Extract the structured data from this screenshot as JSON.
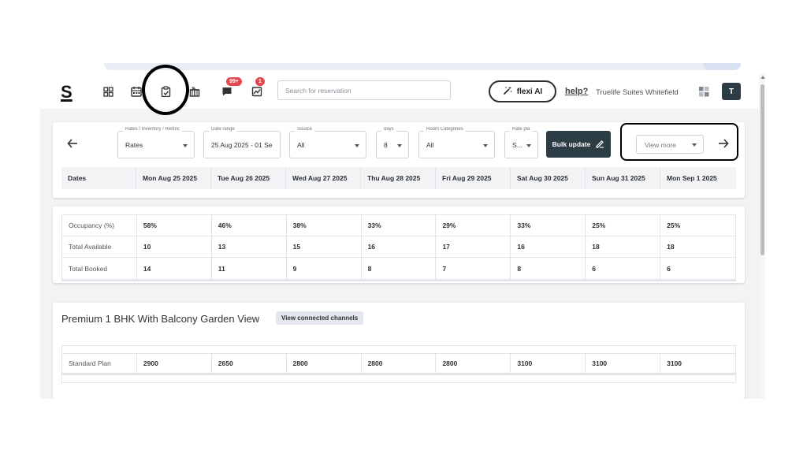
{
  "topbar": {
    "logo": "S",
    "notifications_badge": "99+",
    "reviews_badge": "1",
    "search_placeholder": "Search for reservation",
    "flexi_label": "flexi AI",
    "help_label": "help?",
    "hotel_name": "Truelife Suites Whitefield",
    "avatar_initial": "T"
  },
  "filters": {
    "rates": {
      "label": "Rates / Inventory / Restric",
      "value": "Rates"
    },
    "date_range": {
      "label": "Date range",
      "value": "25 Aug 2025 - 01 Se"
    },
    "source": {
      "label": "Source",
      "value": "All"
    },
    "days": {
      "label": "days",
      "value": "8"
    },
    "room_categories": {
      "label": "Room Categories",
      "value": "All"
    },
    "rate_plan": {
      "label": "Rate pla",
      "value": "S..."
    },
    "bulk_update_label": "Bulk update",
    "view_more_label": "View more"
  },
  "table": {
    "dates_header": "Dates",
    "days": [
      "Mon Aug 25 2025",
      "Tue Aug 26 2025",
      "Wed Aug 27 2025",
      "Thu Aug 28 2025",
      "Fri Aug 29 2025",
      "Sat Aug 30 2025",
      "Sun Aug 31 2025",
      "Mon Sep 1 2025"
    ]
  },
  "stats": {
    "occupancy": {
      "label": "Occupancy (%)",
      "values": [
        "58%",
        "46%",
        "38%",
        "33%",
        "29%",
        "33%",
        "25%",
        "25%"
      ]
    },
    "available": {
      "label": "Total Available",
      "values": [
        "10",
        "13",
        "15",
        "16",
        "17",
        "16",
        "18",
        "18"
      ]
    },
    "booked": {
      "label": "Total Booked",
      "values": [
        "14",
        "11",
        "9",
        "8",
        "7",
        "8",
        "6",
        "6"
      ]
    }
  },
  "room": {
    "title": "Premium 1 BHK With Balcony Garden View",
    "channels_label": "View connected channels",
    "plan": {
      "label": "Standard Plan",
      "values": [
        "2900",
        "2650",
        "2800",
        "2800",
        "2800",
        "3100",
        "3100",
        "3100"
      ]
    }
  },
  "icons": {
    "dashboard": "dashboard-icon",
    "calendar": "calendar-icon",
    "rate_manager": "rate-manager-icon",
    "gift": "gift-icon",
    "chat": "chat-icon",
    "reviews": "reviews-icon",
    "back": "arrow-left-icon",
    "next": "arrow-right-icon"
  },
  "colors": {
    "primary_dark": "#2d3d46",
    "badge_red": "#e5484d",
    "surface": "#f2f3f5"
  }
}
